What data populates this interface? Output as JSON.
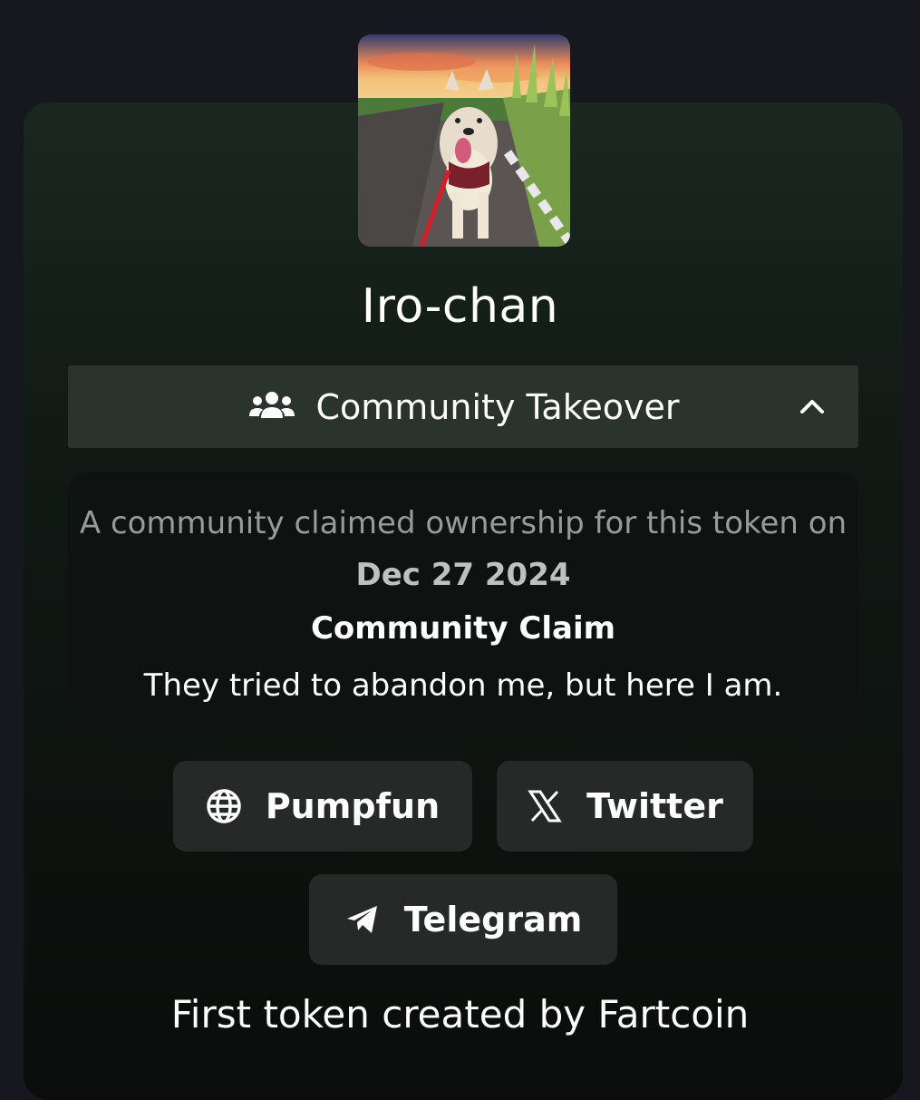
{
  "token": {
    "name": "Iro-chan",
    "avatar_alt": "shiba-dog-photo"
  },
  "community_section": {
    "title": "Community Takeover",
    "icon": "users-icon",
    "toggle_icon": "chevron-up-icon",
    "expanded": true
  },
  "claim": {
    "intro_prefix": "A community claimed ownership for this token on",
    "date": "Dec 27 2024",
    "heading": "Community Claim",
    "text": "They tried to abandon me, but here I am."
  },
  "links": [
    {
      "label": "Pumpfun",
      "icon": "globe-icon"
    },
    {
      "label": "Twitter",
      "icon": "x-logo-icon"
    },
    {
      "label": "Telegram",
      "icon": "telegram-send-icon"
    }
  ],
  "description": "First token created by Fartcoin",
  "colors": {
    "page_bg": "#17171f",
    "card_bg": "#111915",
    "accordion_bg": "#2b332e",
    "button_bg": "#262928",
    "text_primary": "#ffffff",
    "text_muted": "#9a9a9a"
  }
}
